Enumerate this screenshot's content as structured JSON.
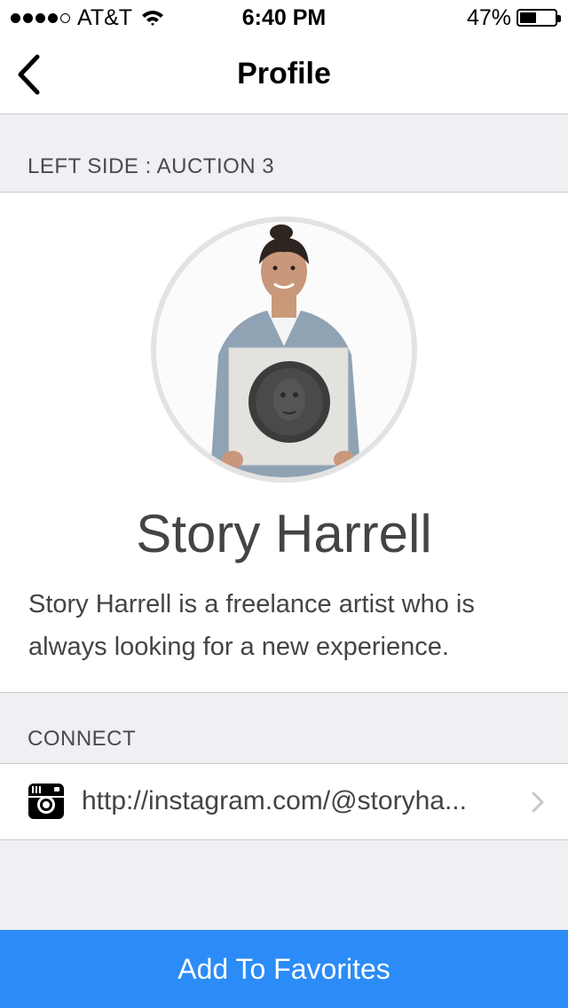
{
  "status_bar": {
    "carrier": "AT&T",
    "time": "6:40 PM",
    "battery_percent": "47%",
    "battery_level": 0.47,
    "signal_bars": 4,
    "icons": [
      "signal-dots-icon",
      "wifi-icon",
      "battery-icon"
    ]
  },
  "nav": {
    "title": "Profile",
    "back_icon": "chevron-left-icon"
  },
  "auction_header": "LEFT SIDE : AUCTION 3",
  "profile": {
    "name": "Story Harrell",
    "bio": "Story Harrell is a freelance artist who is always looking for a new experience.",
    "avatar_icon": "artist-photo"
  },
  "connect": {
    "header": "CONNECT",
    "link_text": "http://instagram.com/@storyha...",
    "link_icon": "instagram-icon",
    "chevron_icon": "chevron-right-icon"
  },
  "actions": {
    "favorites_label": "Add To Favorites"
  },
  "colors": {
    "accent": "#2b8cf7",
    "background": "#efeff4",
    "text": "#444444"
  }
}
